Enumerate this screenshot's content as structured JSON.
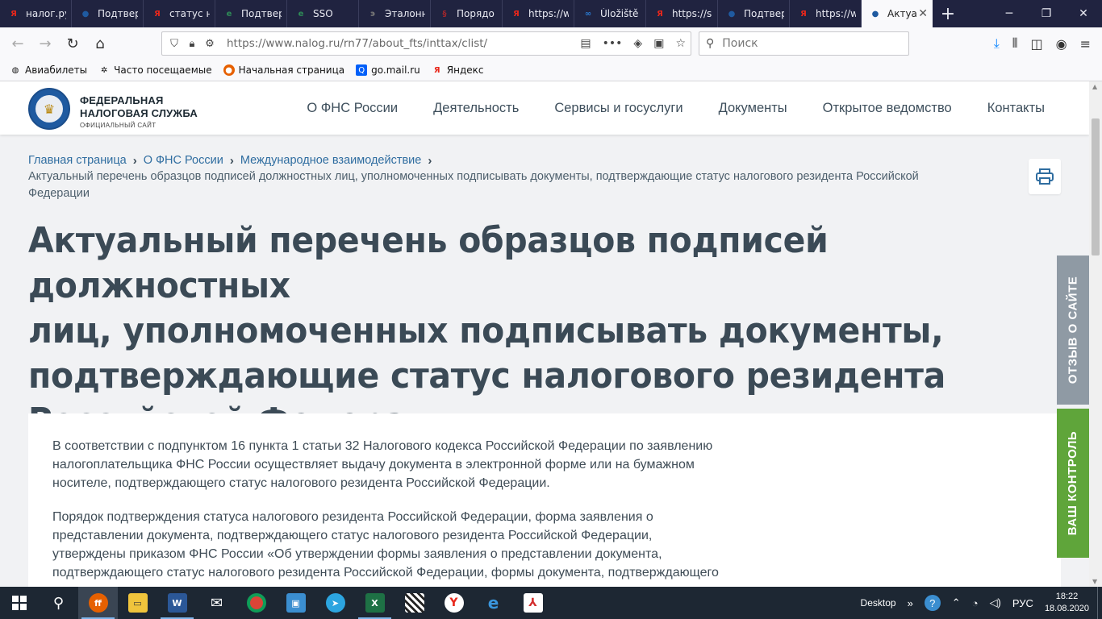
{
  "browser": {
    "tabs": [
      {
        "label": "налог.ру",
        "favicon": "yandex-icon",
        "color": "#e8271b",
        "glyph": "Я"
      },
      {
        "label": "Подтвер",
        "favicon": "fns-emblem-icon",
        "color": "#1f5aa0",
        "glyph": "●"
      },
      {
        "label": "статус н",
        "favicon": "yandex-icon",
        "color": "#e8271b",
        "glyph": "Я"
      },
      {
        "label": "Подтвер",
        "favicon": "egov-icon",
        "color": "#2e8b57",
        "glyph": "e"
      },
      {
        "label": "SSO",
        "favicon": "egov-icon",
        "color": "#2e8b57",
        "glyph": "e"
      },
      {
        "label": "Эталонн",
        "favicon": "etalon-icon",
        "color": "#777777",
        "glyph": "э"
      },
      {
        "label": "Порядо",
        "favicon": "law-icon",
        "color": "#a4262c",
        "glyph": "§"
      },
      {
        "label": "https://w",
        "favicon": "yandex-icon",
        "color": "#e8271b",
        "glyph": "Я"
      },
      {
        "label": "Úložiště",
        "favicon": "storage-icon",
        "color": "#2a7bd3",
        "glyph": "∞"
      },
      {
        "label": "https://s",
        "favicon": "yandex-icon",
        "color": "#e8271b",
        "glyph": "Я"
      },
      {
        "label": "Подтвер",
        "favicon": "fns-emblem-icon",
        "color": "#1f5aa0",
        "glyph": "●"
      },
      {
        "label": "https://w",
        "favicon": "yandex-icon",
        "color": "#e8271b",
        "glyph": "Я"
      },
      {
        "label": "Актуа",
        "favicon": "fns-emblem-icon",
        "color": "#1f5aa0",
        "glyph": "●",
        "active": true
      }
    ],
    "url": "https://www.nalog.ru/rn77/about_fts/inttax/clist/",
    "search_placeholder": "Поиск",
    "bookmarks": [
      {
        "label": "Авиабилеты",
        "icon": "globe-icon"
      },
      {
        "label": "Часто посещаемые",
        "icon": "gear-icon"
      },
      {
        "label": "Начальная страница",
        "icon": "firefox-icon"
      },
      {
        "label": "go.mail.ru",
        "icon": "search-icon"
      },
      {
        "label": "Яндекс",
        "icon": "yandex-icon"
      }
    ]
  },
  "site": {
    "logo": {
      "line1": "ФЕДЕРАЛЬНАЯ",
      "line2": "НАЛОГОВАЯ СЛУЖБА",
      "line3": "ОФИЦИАЛЬНЫЙ САЙТ"
    },
    "nav": [
      "О ФНС России",
      "Деятельность",
      "Сервисы и госуслуги",
      "Документы",
      "Открытое ведомство",
      "Контакты"
    ],
    "breadcrumb": {
      "items": [
        "Главная страница",
        "О ФНС России",
        "Международное взаимодействие"
      ],
      "current": "Актуальный перечень образцов подписей должностных лиц, уполномоченных подписывать документы, подтверждающие статус налогового резидента Российской Федерации"
    },
    "title_lines": [
      "Актуальный перечень образцов подписей должностных",
      "лиц, уполномоченных подписывать документы,",
      "подтверждающие статус налогового резидента",
      "Российской Федерации"
    ],
    "paragraph1_lines": [
      "В соответствии с подпунктом 16 пункта 1 статьи 32 Налогового кодекса Российской Федерации по заявлению",
      "налогоплательщика ФНС России осуществляет выдачу документа в электронной форме или на бумажном",
      "носителе, подтверждающего статус налогового резидента Российской Федерации."
    ],
    "paragraph2_lines": [
      "Порядок подтверждения статуса налогового резидента Российской Федерации, форма заявления о",
      "представлении документа, подтверждающего статус налогового резидента Российской Федерации,",
      "утверждены приказом ФНС России «Об утверждении формы заявления о представлении документа,",
      "подтверждающего статус налогового резидента Российской Федерации, формы документа, подтверждающего"
    ],
    "side_feedback": "ОТЗЫВ О САЙТЕ",
    "side_control": "ВАШ КОНТРОЛЬ"
  },
  "taskbar": {
    "apps": [
      "firefox-icon",
      "explorer-icon",
      "word-icon",
      "mail-icon",
      "chrome-icon",
      "remote-desktop-icon",
      "telegram-icon",
      "excel-icon",
      "app-icon",
      "yandex-browser-icon",
      "edge-icon",
      "pdf-icon"
    ],
    "desktop_label": "Desktop",
    "language": "РУС",
    "time": "18:22",
    "date": "18.08.2020"
  },
  "colors": {
    "title": "#3b4a56",
    "link": "#2f6da0",
    "feedback_tab": "#8f9aa4",
    "control_tab": "#5fa53a",
    "tabstrip": "#202340"
  }
}
